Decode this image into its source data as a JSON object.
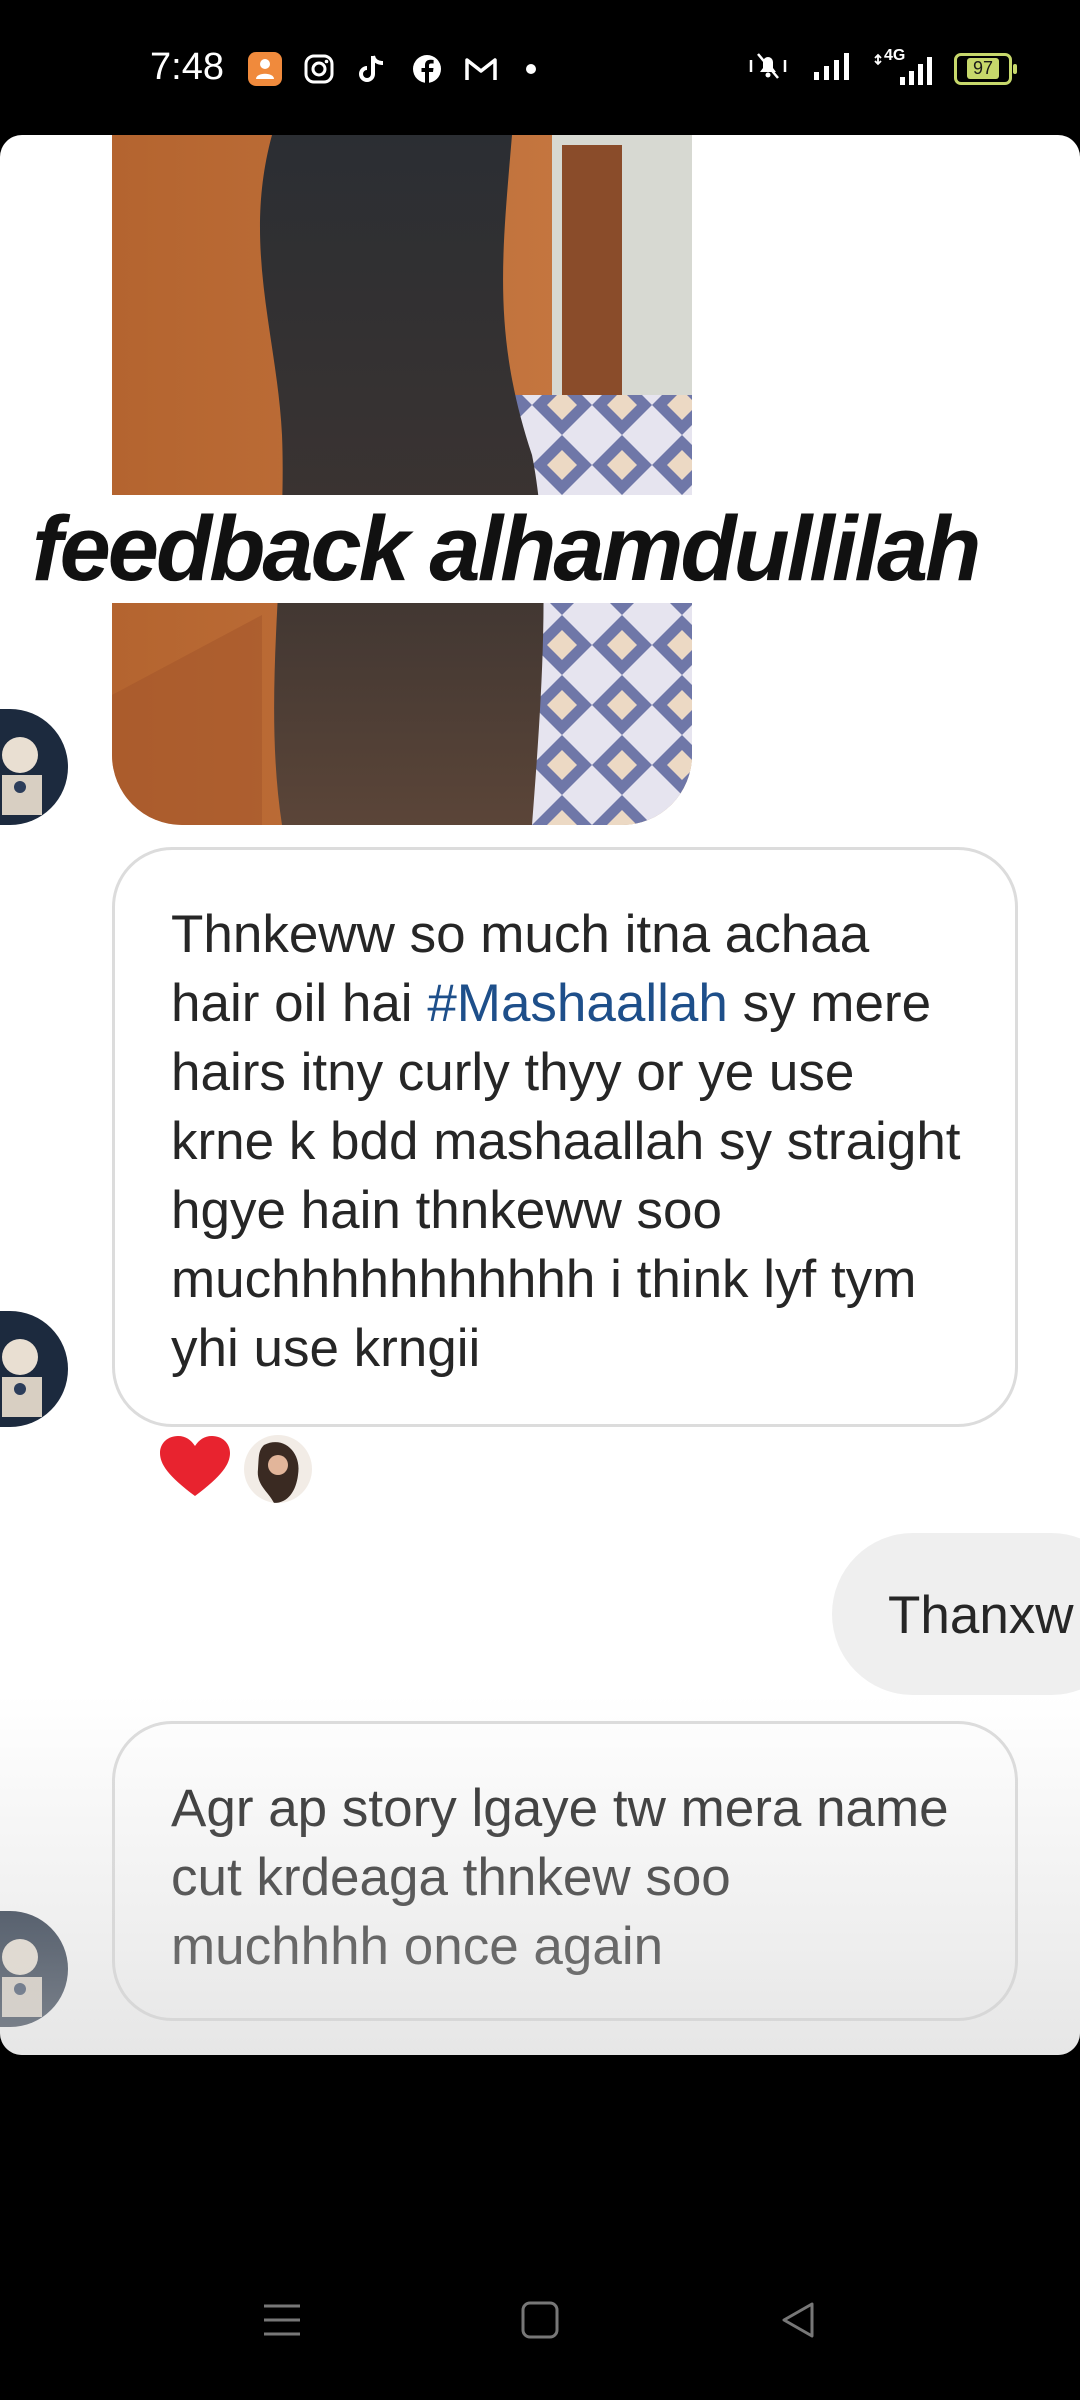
{
  "status_bar": {
    "time": "7:48",
    "network": "4G",
    "battery": "97",
    "app_icons": [
      "contact-icon",
      "instagram-icon",
      "tiktok-icon",
      "facebook-icon",
      "gmail-icon"
    ]
  },
  "story": {
    "caption": "feedback alhamdullilah",
    "messages": [
      {
        "direction": "received",
        "segments": [
          {
            "text": "Thnkeww so much itna achaa hair oil hai "
          },
          {
            "text": "#Mashaallah",
            "hashtag": true
          },
          {
            "text": " sy mere hairs itny curly thyy or ye use krne k bdd mashaallah sy straight hgye hain thnkeww soo muchhhhhhhhhhh i think lyf tym yhi use krngii"
          }
        ]
      },
      {
        "direction": "sent",
        "text": "Thanxw"
      },
      {
        "direction": "received",
        "text": "Agr ap story lgaye tw mera name cut krdeaga thnkew soo muchhhh once again"
      }
    ],
    "reaction_emoji": "heart",
    "colors": {
      "hashtag": "#1e4f8a",
      "heart": "#e8232f",
      "bubble_border": "#dcdcdc",
      "sent_bubble": "#efefef"
    }
  },
  "nav_bar": {
    "buttons": [
      "menu-icon",
      "home-icon",
      "back-icon"
    ]
  }
}
